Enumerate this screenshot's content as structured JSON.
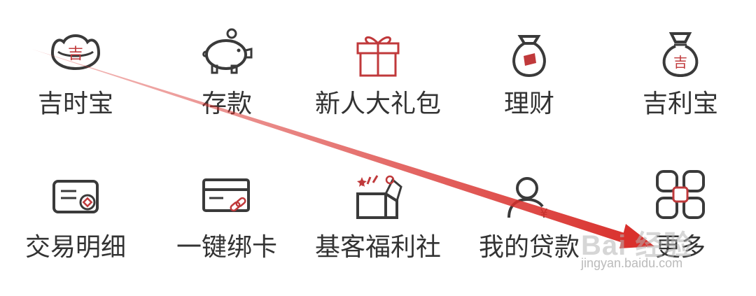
{
  "menu": {
    "row1": [
      {
        "label": "吉时宝",
        "icon": "gold-ingot-icon",
        "icon_text": "吉"
      },
      {
        "label": "存款",
        "icon": "piggy-bank-icon"
      },
      {
        "label": "新人大礼包",
        "icon": "gift-box-icon"
      },
      {
        "label": "理财",
        "icon": "money-bag-icon"
      },
      {
        "label": "吉利宝",
        "icon": "lucky-bag-icon",
        "icon_text": "吉"
      }
    ],
    "row2": [
      {
        "label": "交易明细",
        "icon": "transaction-record-icon"
      },
      {
        "label": "一键绑卡",
        "icon": "bind-card-icon"
      },
      {
        "label": "基客福利社",
        "icon": "open-gift-box-icon"
      },
      {
        "label": "我的贷款",
        "icon": "user-loan-icon",
        "icon_text": "¥"
      },
      {
        "label": "更多",
        "icon": "more-grid-icon"
      }
    ]
  },
  "watermark": {
    "brand": "Bai 经验",
    "url": "jingyan.baidu.com"
  },
  "colors": {
    "icon_stroke": "#3a3a3a",
    "accent": "#c0393b",
    "label": "#333333",
    "arrow": "#d9302c"
  }
}
